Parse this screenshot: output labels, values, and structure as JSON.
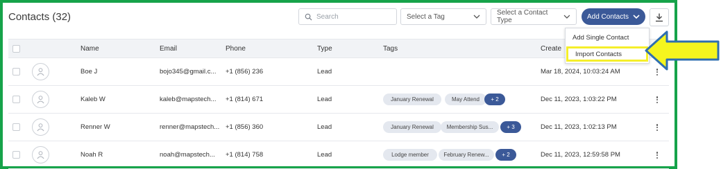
{
  "header": {
    "title": "Contacts (32)",
    "search_placeholder": "Search",
    "tag_select": "Select a Tag",
    "type_select": "Select a Contact Type",
    "add_button": "Add Contacts"
  },
  "columns": [
    "Name",
    "Email",
    "Phone",
    "Type",
    "Tags",
    "Create"
  ],
  "rows": [
    {
      "name": "Boe J",
      "email": "bojo345@gmail.c...",
      "phone": "+1 (856) 236",
      "type": "Lead",
      "tags": [],
      "more": "",
      "created": "Mar 18, 2024, 10:03:24 AM"
    },
    {
      "name": "Kaleb W",
      "email": "kaleb@mapstech...",
      "phone": "+1 (814) 671",
      "type": "Lead",
      "tags": [
        "January Renewal",
        "May Attend"
      ],
      "more": "+ 2",
      "created": "Dec 11, 2023, 1:03:22 PM"
    },
    {
      "name": "Renner W",
      "email": "renner@mapstech...",
      "phone": "+1 (856) 360",
      "type": "Lead",
      "tags": [
        "January Renewal",
        "Membership Sus..."
      ],
      "more": "+ 3",
      "created": "Dec 11, 2023, 1:02:13 PM"
    },
    {
      "name": "Noah R",
      "email": "noah@mapstech...",
      "phone": "+1 (814) 758",
      "type": "Lead",
      "tags": [
        "Lodge member",
        "February Renew..."
      ],
      "more": "+ 2",
      "created": "Dec 11, 2023, 12:59:58 PM"
    }
  ],
  "dropdown": {
    "items": [
      "Add Single Contact",
      "Import Contacts"
    ]
  },
  "colors": {
    "frame": "#16a34a",
    "accent": "#3b5998",
    "highlight": "#f5ef2a"
  }
}
